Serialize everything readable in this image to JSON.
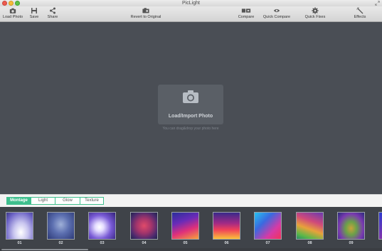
{
  "window": {
    "title": "PicLight"
  },
  "toolbar": {
    "load_photo": "Load Photo",
    "save": "Save",
    "share": "Share",
    "revert": "Revert to Original",
    "compare": "Compare",
    "quick_compare": "Quick Compare",
    "quick_fixes": "Quick Fixes",
    "effects": "Effects"
  },
  "canvas": {
    "drop_title": "Load/Import Photo",
    "drop_hint": "You can drag&drop your photo here"
  },
  "tabs": [
    {
      "label": "Montage",
      "active": true
    },
    {
      "label": "Light",
      "active": false
    },
    {
      "label": "Glow",
      "active": false
    },
    {
      "label": "Texture",
      "active": false
    }
  ],
  "filters": [
    {
      "label": "01"
    },
    {
      "label": "02"
    },
    {
      "label": "03"
    },
    {
      "label": "04"
    },
    {
      "label": "05"
    },
    {
      "label": "06"
    },
    {
      "label": "07"
    },
    {
      "label": "08"
    },
    {
      "label": "09"
    }
  ],
  "colors": {
    "accent": "#3fbf8e",
    "canvas_bg": "#4a4e55"
  }
}
